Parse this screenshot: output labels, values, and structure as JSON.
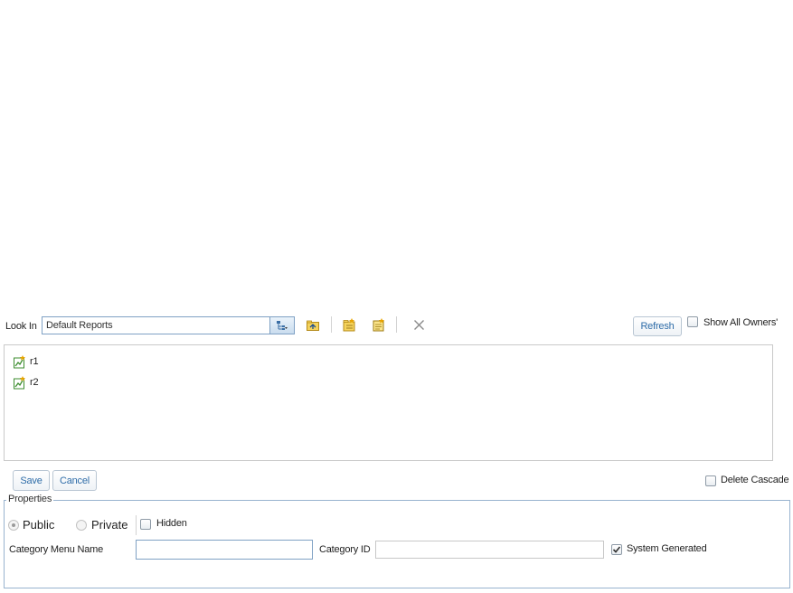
{
  "look_in": {
    "label": "Look In",
    "value": "Default Reports"
  },
  "toolbar": {
    "refresh_label": "Refresh",
    "show_all_owners_label": "Show All Owners'",
    "show_all_owners_checked": false
  },
  "icons": {
    "tree": "tree-icon",
    "up_folder": "up-folder-icon",
    "new_folder": "new-folder-icon",
    "new_report": "new-report-icon",
    "delete": "close-icon"
  },
  "list": {
    "items": [
      {
        "label": "r1",
        "icon": "report-icon"
      },
      {
        "label": "r2",
        "icon": "report-icon"
      }
    ]
  },
  "actions": {
    "save_label": "Save",
    "cancel_label": "Cancel",
    "delete_cascade_label": "Delete Cascade",
    "delete_cascade_checked": false
  },
  "properties": {
    "legend": "Properties",
    "public_label": "Public",
    "private_label": "Private",
    "hidden_label": "Hidden",
    "selected_visibility": "Public",
    "hidden_checked": false,
    "category_menu_name_label": "Category Menu Name",
    "category_menu_name_value": "",
    "category_id_label": "Category ID",
    "category_id_value": "",
    "system_generated_label": "System Generated",
    "system_generated_checked": true
  },
  "colors": {
    "accent": "#2e6ca8",
    "border": "#7fa1c4",
    "fieldset_border": "#98b3cf"
  }
}
